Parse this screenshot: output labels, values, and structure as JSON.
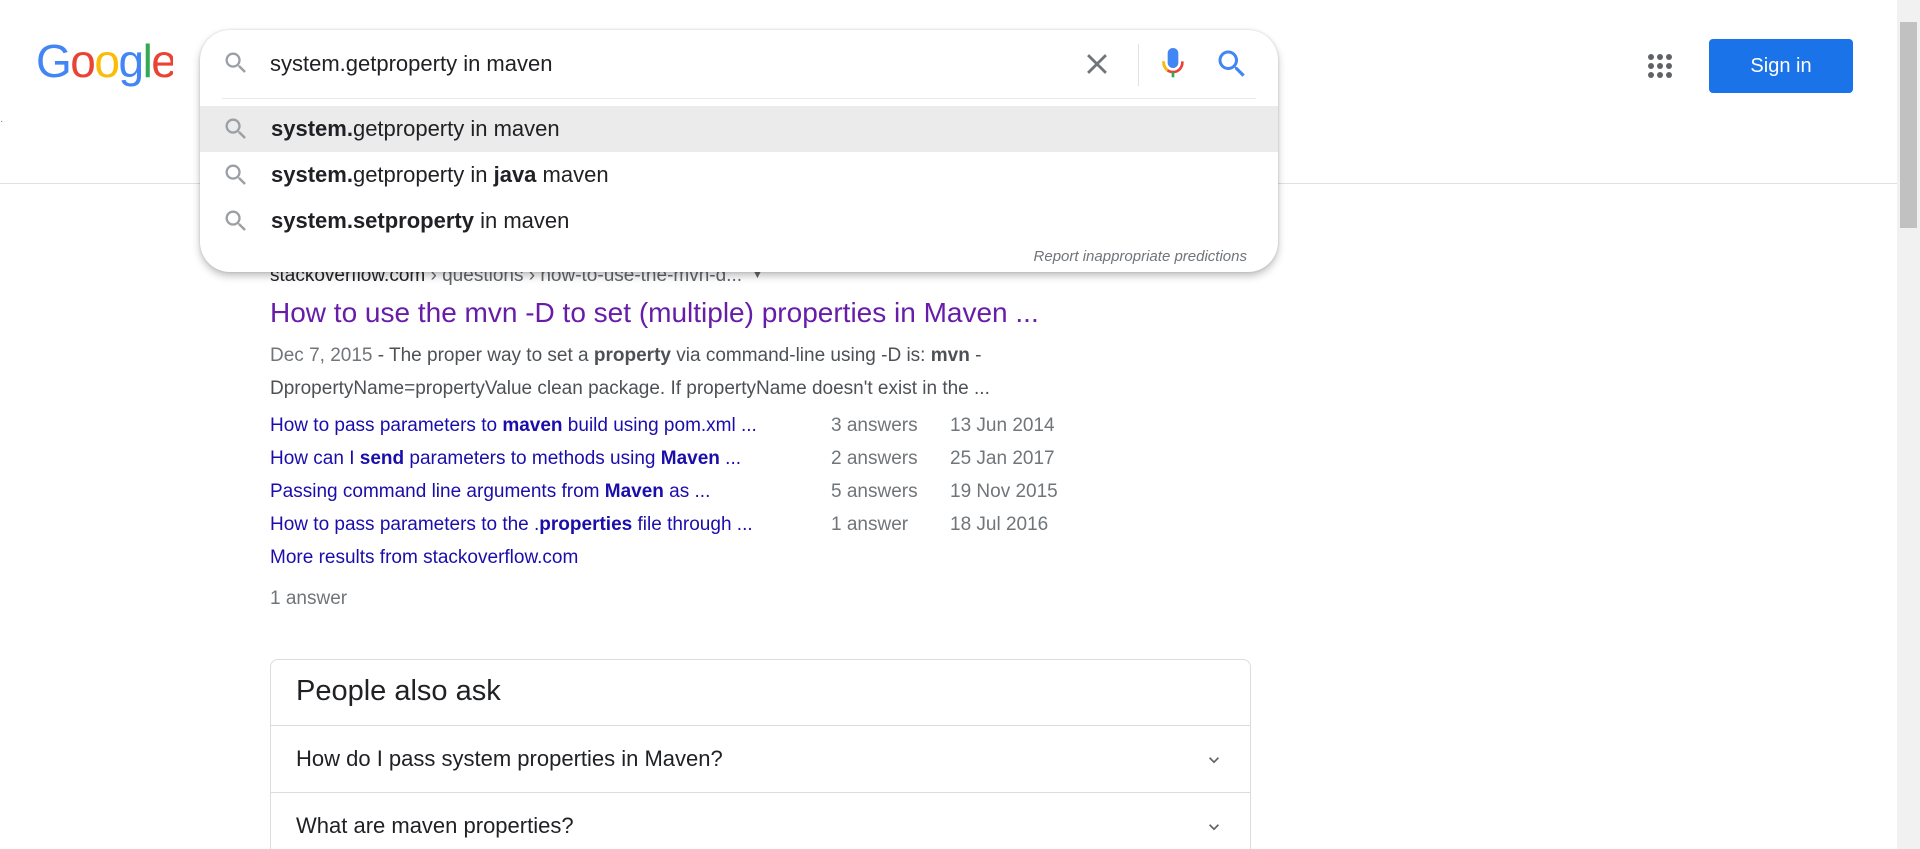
{
  "header": {
    "logo_text": "Google",
    "left_edge_mark": "·",
    "apps_icon": "apps-grid-icon",
    "signin_label": "Sign in",
    "colors": {
      "accent": "#1a73e8",
      "visited_link": "#681da8",
      "link": "#1a0dab"
    }
  },
  "search": {
    "query": "system.getproperty in maven",
    "icons": [
      "search-icon",
      "clear-icon",
      "mic-icon",
      "search-submit-icon"
    ],
    "suggestions": [
      {
        "parts": [
          {
            "text": "system.",
            "bold": true
          },
          {
            "text": "getproperty in maven",
            "bold": false
          }
        ]
      },
      {
        "parts": [
          {
            "text": "system.",
            "bold": true
          },
          {
            "text": "getproperty in ",
            "bold": false
          },
          {
            "text": "java",
            "bold": true
          },
          {
            "text": " maven",
            "bold": false
          }
        ]
      },
      {
        "parts": [
          {
            "text": "system.setproperty",
            "bold": true
          },
          {
            "text": " in maven",
            "bold": false
          }
        ]
      }
    ],
    "report_label": "Report inappropriate predictions"
  },
  "result": {
    "site": "stackoverflow.com",
    "path": " › questions › how-to-use-the-mvn-d...",
    "title": "How to use the mvn -D to set (multiple) properties in Maven ...",
    "snippet": {
      "date": "Dec 7, 2015",
      "parts": [
        {
          "text": " - The proper way to set a ",
          "bold": false
        },
        {
          "text": "property",
          "bold": true
        },
        {
          "text": " via command-line using -D is: ",
          "bold": false
        },
        {
          "text": "mvn",
          "bold": true
        },
        {
          "text": " -DpropertyName=propertyValue clean package. If propertyName doesn't exist in the ...",
          "bold": false
        }
      ]
    },
    "sitelinks": [
      {
        "parts": [
          {
            "text": "How to pass parameters to ",
            "bold": false
          },
          {
            "text": "maven",
            "bold": true
          },
          {
            "text": " build using pom.xml ...",
            "bold": false
          }
        ],
        "answers": "3 answers",
        "date": "13 Jun 2014"
      },
      {
        "parts": [
          {
            "text": "How can I ",
            "bold": false
          },
          {
            "text": "send",
            "bold": true
          },
          {
            "text": " parameters to methods using ",
            "bold": false
          },
          {
            "text": "Maven",
            "bold": true
          },
          {
            "text": " ...",
            "bold": false
          }
        ],
        "answers": "2 answers",
        "date": "25 Jan 2017"
      },
      {
        "parts": [
          {
            "text": "Passing command line arguments from ",
            "bold": false
          },
          {
            "text": "Maven",
            "bold": true
          },
          {
            "text": " as ...",
            "bold": false
          }
        ],
        "answers": "5 answers",
        "date": "19 Nov 2015"
      },
      {
        "parts": [
          {
            "text": "How to pass parameters to the .",
            "bold": false
          },
          {
            "text": "properties",
            "bold": true
          },
          {
            "text": " file through ...",
            "bold": false
          }
        ],
        "answers": "1 answer",
        "date": "18 Jul 2016"
      }
    ],
    "more_results": "More results from stackoverflow.com",
    "answer_count": "1 answer"
  },
  "people_also_ask": {
    "heading": "People also ask",
    "questions": [
      "How do I pass system properties in Maven?",
      "What are maven properties?"
    ]
  }
}
